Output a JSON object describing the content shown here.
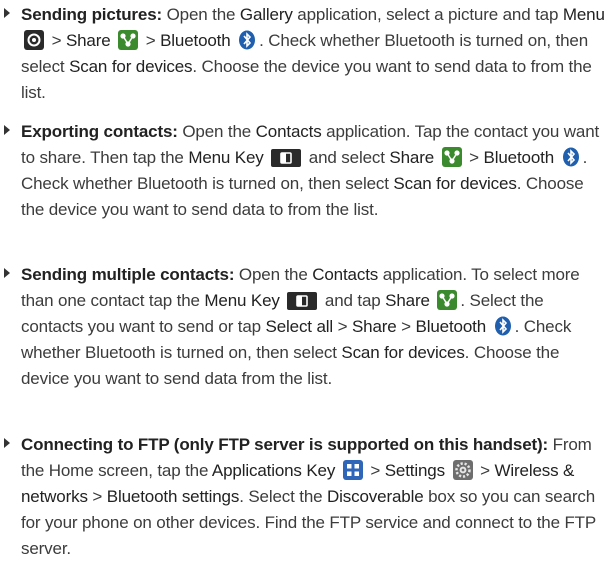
{
  "items": [
    {
      "lead": "Sending pictures:",
      "t1": " Open the ",
      "gallery": "Gallery",
      "t2": " application, select a picture and tap ",
      "menu": "Menu",
      "gt1": " > ",
      "share": "Share",
      "gt2": " > ",
      "bluetooth": "Bluetooth",
      "t3": ". Check whether Bluetooth is turned on, then select ",
      "scan": "Scan for devices",
      "t4": ". Choose the device you want to send data to from the list."
    },
    {
      "lead": "Exporting contacts:",
      "t1": " Open the ",
      "contacts": "Contacts",
      "t2": " application. Tap the contact you want to share. Then tap the ",
      "menukey": "Menu Key",
      "t3": " and select ",
      "share": "Share",
      "gt1": " > ",
      "bluetooth": "Bluetooth",
      "t4": ". Check whether Bluetooth is turned on, then select ",
      "scan": "Scan for devices",
      "t5": ". Choose the device you want to send data to from the list."
    },
    {
      "lead": "Sending multiple contacts:",
      "t1": " Open the ",
      "contacts": "Contacts",
      "t2": " application. To select more than one contact tap the ",
      "menukey": "Menu Key",
      "t3": " and tap ",
      "share": "Share",
      "t4": ". Select the contacts you want to send or tap ",
      "selectall": "Select all",
      "gt1": " > ",
      "share2": "Share",
      "gt2": " > ",
      "bluetooth": "Bluetooth",
      "t5": ". Check whether Bluetooth is turned on, then select ",
      "scan": "Scan for devices",
      "t6": ". Choose the device you want to send data from the list."
    },
    {
      "lead": "Connecting to FTP (only FTP server is supported on this handset):",
      "t1": " From the Home screen, tap the ",
      "appskey": "Applications Key",
      "gt1": " > ",
      "settings": "Settings",
      "gt2": " > ",
      "wireless": "Wireless & networks",
      "gt3": " > ",
      "btsettings": "Bluetooth settings",
      "t2": ". Select the ",
      "discoverable": "Discoverable",
      "t3": " box so you can search for your phone on other devices. Find the FTP service and connect to the FTP server."
    }
  ],
  "icons": {
    "menu": "menu-icon",
    "share": "share-icon",
    "bluetooth": "bluetooth-icon",
    "menukey": "menu-key-icon",
    "appskey": "applications-key-icon",
    "settings": "settings-icon"
  }
}
